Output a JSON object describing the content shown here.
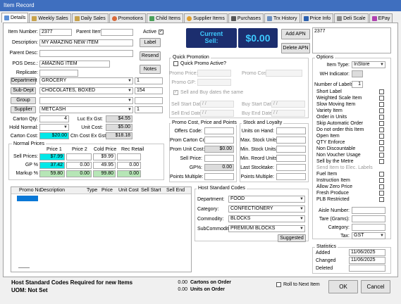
{
  "window": {
    "title": "Item Record"
  },
  "tabs": [
    "Details",
    "Weekly Sales",
    "Daily Sales",
    "Promotions",
    "Child Items",
    "Supplier Items",
    "Purchases",
    "Trx History",
    "Price Info",
    "Deli Scale",
    "EPay"
  ],
  "colors": {
    "titlebar": "#3f6fbf",
    "current_sell_bg": "#1c2e6e",
    "current_sell_fg": "#3ec9ff",
    "price_cyan": "#00e8e8",
    "margin_green": "#b6e6b6"
  },
  "details": {
    "item_number_label": "Item Number:",
    "item_number": "2377",
    "parent_item_label": "Parent Item",
    "parent_item": "",
    "active_label": "Active",
    "description_label": "Description:",
    "description": "MY AMAZING NEW ITEM",
    "parent_desc_label": "Parent Desc:",
    "parent_desc": "",
    "pos_desc_label": "POS Desc.:",
    "pos_desc": "AMAZING ITEM",
    "replicate_label": "Replicate:",
    "replicate": "",
    "department_label": "Department",
    "department": "GROCERY",
    "department_code": "1",
    "subdept_label": "Sub-Dept",
    "subdept": "CHOCOLATES, BOXED",
    "subdept_code": "154",
    "group_label": "Group",
    "group": "",
    "group_code": "",
    "supplier_label": "Supplier",
    "supplier": "METCASH",
    "supplier_code": "1",
    "carton_qty_label": "Carton Qty:",
    "carton_qty": "4",
    "hold_normal_label": "Hold Normal:",
    "hold_normal": "",
    "carton_cost_label": "Carton Cost:",
    "carton_cost": "$20.00",
    "luc_ex_gst_label": "Luc Ex Gst:",
    "luc_ex_gst": "$4.55",
    "unit_cost_label": "Unit Cost:",
    "unit_cost": "$5.00",
    "ctn_cost_ex_gst_label": "Ctn Cost Ex Gst:",
    "ctn_cost_ex_gst": "$18.18",
    "label_button": "Label",
    "resend_button": "Resend",
    "notes_button": "Notes",
    "current_sell_label1": "Current",
    "current_sell_label2": "Sell:",
    "current_sell": "$0.00",
    "add_apn_button": "Add APN",
    "delete_apn_button": "Delete APN",
    "apn_value": "2377"
  },
  "normal_prices": {
    "title": "Normal Prices",
    "headers": [
      "Price 1",
      "Price 2",
      "Cold Price",
      "Rec Retail"
    ],
    "rows": [
      {
        "label": "Sell Prices:",
        "values": [
          "$7.99",
          "",
          "$9.99",
          ""
        ]
      },
      {
        "label": "GP %",
        "values": [
          "37.42",
          "0.00",
          "49.95",
          "0.00"
        ]
      },
      {
        "label": "Markup %",
        "values": [
          "59.80",
          "0.00",
          "99.80",
          "0.00"
        ]
      }
    ]
  },
  "quick_promo": {
    "title": "Quick Promotion",
    "active_label": "Quick Promo Active?",
    "promo_price_label": "Promo Price:",
    "promo_cost_label": "Promo Cost:",
    "promo_gp_label": "Promo GP:",
    "same_dates_label": "Sell and Buy dates the same",
    "sell_start_label": "Sell Start Date:",
    "sell_end_label": "Sell End Date:",
    "buy_start_label": "Buy Start Date:",
    "buy_end_label": "Buy End Date:",
    "date_placeholder": "/ /"
  },
  "promo_cost": {
    "title": "Promo Cost, Price and Points",
    "offers_code_label": "Offers Code:",
    "prom_carton_cost_label": "Prom Carton Cost:",
    "prom_unit_cost_label": "Prom Unit Cost:",
    "prom_unit_cost": "$0.00",
    "sell_price_label": "Sell Price:",
    "gp_label": "GP%:",
    "gp": "0.00",
    "points_multiple_label": "Points Multiple:"
  },
  "stock": {
    "title": "Stock and Loyalty",
    "on_hand_label": "Units on Hand:",
    "max_units_label": "Max. Stock Units:",
    "min_units_label": "Min. Stock Units:",
    "min_reord_label": "Min. Reord Units:",
    "last_stocktake_label": "Last Stocktake:",
    "points_multiple_label": "Points Multiple:"
  },
  "promo_table": {
    "headers": [
      "Promo No",
      "Description",
      "Type",
      "Price",
      "Unit Cost",
      "Sell Start",
      "Sell End"
    ]
  },
  "host": {
    "title": "Host Standard Codes",
    "department_label": "Department:",
    "department": "FOOD",
    "category_label": "Category:",
    "category": "CONFECTIONERY",
    "commodity_label": "Commodity:",
    "commodity": "BLOCKS",
    "subcommodity_label": "SubCommodity:",
    "subcommodity": "PREMIUM BLOCKS",
    "suggested_button": "Suggested"
  },
  "options": {
    "title": "Options",
    "item_type_label": "Item Type:",
    "item_type": "InStore",
    "wh_indicator_label": "WH Indicator:",
    "num_labels_label": "Number of Labels:",
    "num_labels": "1",
    "checks": [
      "Short Label",
      "Weighted Scale Item",
      "Slow Moving Item",
      "Variety Item",
      "Order in Units",
      "Skip Automatic Order",
      "Do not order this Item",
      "Open Item",
      "QTY Enforce",
      "Non Discountable",
      "Non Voucher Usage",
      "Sell by the Metre",
      "Send Item to Elec. Labels",
      "Fuel Item",
      "Instruction Item",
      "Allow Zero Price",
      "Fresh Produce",
      "PLB Restricted"
    ],
    "aisle_label": "Aisle Number:",
    "tare_label": "Tare (Grams):",
    "category_label": "Category:",
    "tax_label": "Tax:",
    "tax": "GST"
  },
  "statistics": {
    "title": "Statistics",
    "added_label": "Added",
    "added": "11/06/2025",
    "changed_label": "Changed",
    "changed": "11/06/2025",
    "deleted_label": "Deleted",
    "deleted": ""
  },
  "footer": {
    "host_warning": "Host Standard Codes Required for new Items",
    "uom_label": "UOM: Not Set",
    "cartons_value": "0.00",
    "cartons_label": "Cartons on Order",
    "units_value": "0.00",
    "units_label": "Units on Order",
    "roll_label": "Roll to Next Item",
    "ok_button": "OK",
    "cancel_button": "Cancel"
  }
}
